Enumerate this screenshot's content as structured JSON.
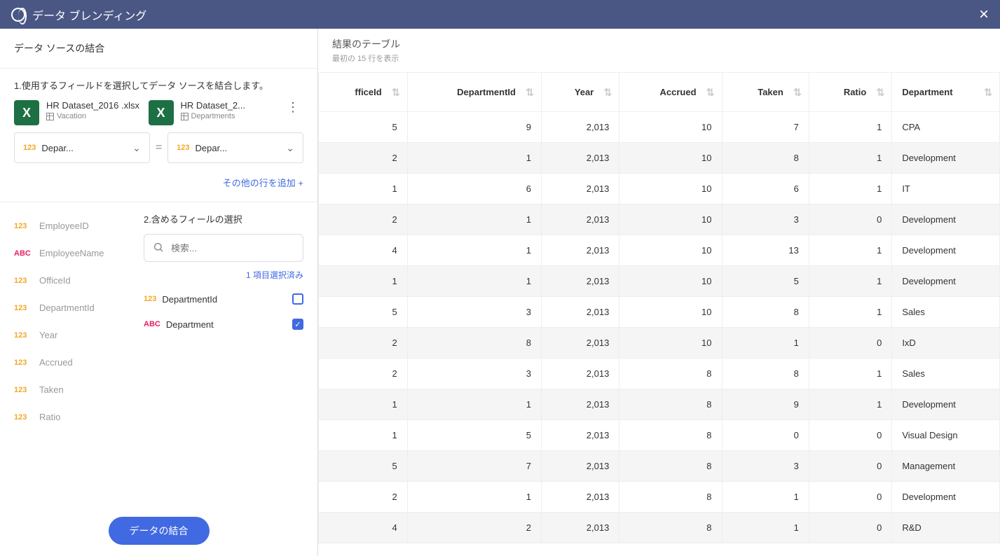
{
  "header": {
    "title": "データ ブレンディング"
  },
  "leftPanel": {
    "sectionTitle": "データ ソースの結合",
    "step1Label": "1.使用するフィールドを選択してデータ ソースを結合します。",
    "source1": {
      "name": "HR Dataset_2016 .xlsx",
      "sub": "Vacation"
    },
    "source2": {
      "name": "HR Dataset_2...",
      "sub": "Departments"
    },
    "joinField1": "Depar...",
    "joinField2": "Depar...",
    "addRowLabel": "その他の行を追加 +",
    "source1Fields": [
      {
        "type": "123",
        "name": "EmployeeID"
      },
      {
        "type": "ABC",
        "name": "EmployeeName"
      },
      {
        "type": "123",
        "name": "OfficeId"
      },
      {
        "type": "123",
        "name": "DepartmentId"
      },
      {
        "type": "123",
        "name": "Year"
      },
      {
        "type": "123",
        "name": "Accrued"
      },
      {
        "type": "123",
        "name": "Taken"
      },
      {
        "type": "123",
        "name": "Ratio"
      }
    ],
    "step2Label": "2.含めるフィールの選択",
    "searchPlaceholder": "検索...",
    "selectedCount": "1 項目選択済み",
    "includeFields": [
      {
        "type": "123",
        "name": "DepartmentId",
        "checked": false
      },
      {
        "type": "ABC",
        "name": "Department",
        "checked": true
      }
    ],
    "joinButton": "データの結合"
  },
  "rightPanel": {
    "title": "結果のテーブル",
    "sub": "最初の 15 行を表示",
    "columns": [
      {
        "label": "fficeId",
        "num": true
      },
      {
        "label": "DepartmentId",
        "num": true
      },
      {
        "label": "Year",
        "num": true
      },
      {
        "label": "Accrued",
        "num": true
      },
      {
        "label": "Taken",
        "num": true
      },
      {
        "label": "Ratio",
        "num": true
      },
      {
        "label": "Department",
        "num": false
      }
    ],
    "rows": [
      [
        "5",
        "9",
        "2,013",
        "10",
        "7",
        "1",
        "CPA"
      ],
      [
        "2",
        "1",
        "2,013",
        "10",
        "8",
        "1",
        "Development"
      ],
      [
        "1",
        "6",
        "2,013",
        "10",
        "6",
        "1",
        "IT"
      ],
      [
        "2",
        "1",
        "2,013",
        "10",
        "3",
        "0",
        "Development"
      ],
      [
        "4",
        "1",
        "2,013",
        "10",
        "13",
        "1",
        "Development"
      ],
      [
        "1",
        "1",
        "2,013",
        "10",
        "5",
        "1",
        "Development"
      ],
      [
        "5",
        "3",
        "2,013",
        "10",
        "8",
        "1",
        "Sales"
      ],
      [
        "2",
        "8",
        "2,013",
        "10",
        "1",
        "0",
        "IxD"
      ],
      [
        "2",
        "3",
        "2,013",
        "8",
        "8",
        "1",
        "Sales"
      ],
      [
        "1",
        "1",
        "2,013",
        "8",
        "9",
        "1",
        "Development"
      ],
      [
        "1",
        "5",
        "2,013",
        "8",
        "0",
        "0",
        "Visual Design"
      ],
      [
        "5",
        "7",
        "2,013",
        "8",
        "3",
        "0",
        "Management"
      ],
      [
        "2",
        "1",
        "2,013",
        "8",
        "1",
        "0",
        "Development"
      ],
      [
        "4",
        "2",
        "2,013",
        "8",
        "1",
        "0",
        "R&D"
      ]
    ]
  }
}
